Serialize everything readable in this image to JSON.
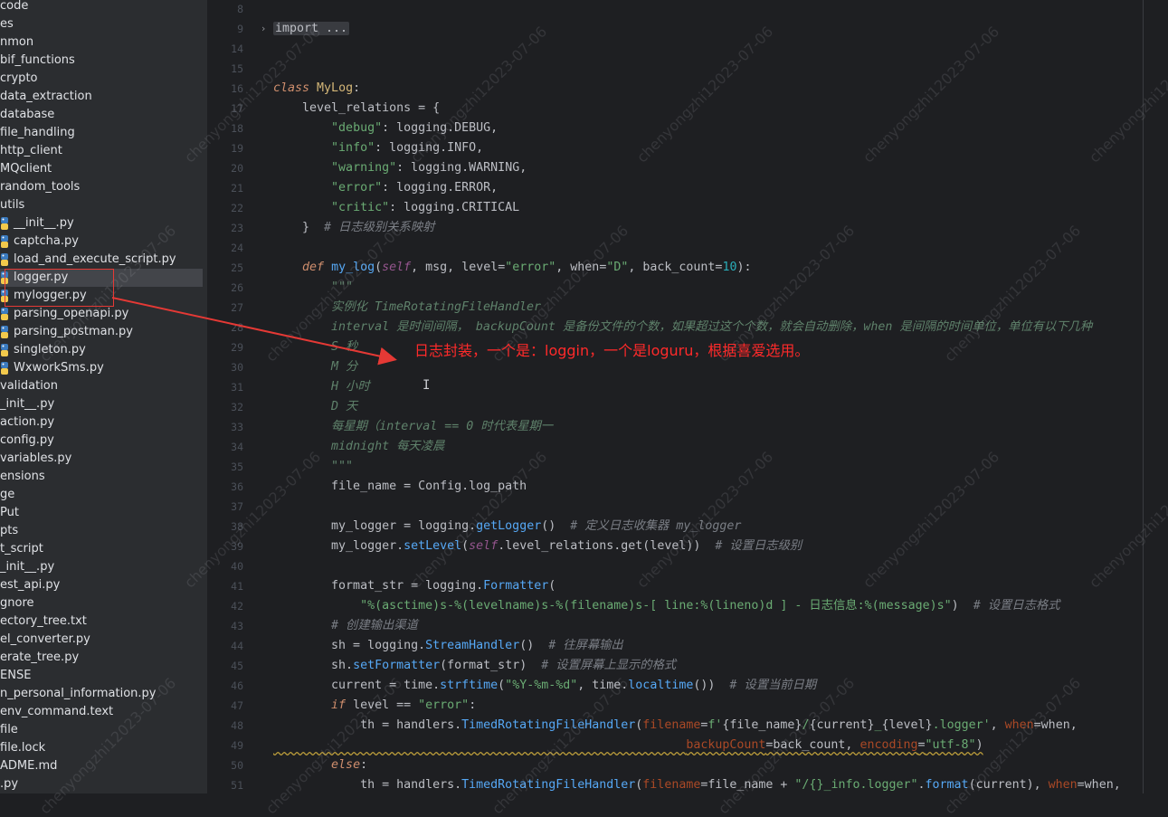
{
  "project_tree": {
    "items": [
      {
        "label": "code",
        "type": "folder"
      },
      {
        "label": "es",
        "type": "folder"
      },
      {
        "label": "nmon",
        "type": "folder"
      },
      {
        "label": "bif_functions",
        "type": "folder"
      },
      {
        "label": "crypto",
        "type": "folder"
      },
      {
        "label": "data_extraction",
        "type": "folder"
      },
      {
        "label": "database",
        "type": "folder"
      },
      {
        "label": "file_handling",
        "type": "folder"
      },
      {
        "label": "http_client",
        "type": "folder"
      },
      {
        "label": "MQclient",
        "type": "folder"
      },
      {
        "label": "random_tools",
        "type": "folder"
      },
      {
        "label": "utils",
        "type": "folder"
      },
      {
        "label": "__init__.py",
        "type": "py"
      },
      {
        "label": "captcha.py",
        "type": "py"
      },
      {
        "label": "load_and_execute_script.py",
        "type": "py"
      },
      {
        "label": "logger.py",
        "type": "py",
        "selected": true
      },
      {
        "label": "mylogger.py",
        "type": "py"
      },
      {
        "label": "parsing_openapi.py",
        "type": "py"
      },
      {
        "label": "parsing_postman.py",
        "type": "py"
      },
      {
        "label": "singleton.py",
        "type": "py"
      },
      {
        "label": "WxworkSms.py",
        "type": "py"
      },
      {
        "label": "validation",
        "type": "folder"
      },
      {
        "label": "_init__.py",
        "type": "file"
      },
      {
        "label": "action.py",
        "type": "file"
      },
      {
        "label": "config.py",
        "type": "file"
      },
      {
        "label": "variables.py",
        "type": "file"
      },
      {
        "label": "ensions",
        "type": "folder"
      },
      {
        "label": "ge",
        "type": "folder"
      },
      {
        "label": "Put",
        "type": "folder"
      },
      {
        "label": "pts",
        "type": "folder"
      },
      {
        "label": "t_script",
        "type": "folder"
      },
      {
        "label": "_init__.py",
        "type": "file"
      },
      {
        "label": "est_api.py",
        "type": "file"
      },
      {
        "label": "gnore",
        "type": "file"
      },
      {
        "label": "ectory_tree.txt",
        "type": "file"
      },
      {
        "label": "el_converter.py",
        "type": "file"
      },
      {
        "label": "erate_tree.py",
        "type": "file"
      },
      {
        "label": "ENSE",
        "type": "file"
      },
      {
        "label": "n_personal_information.py",
        "type": "file"
      },
      {
        "label": "env_command.text",
        "type": "file"
      },
      {
        "label": "file",
        "type": "file"
      },
      {
        "label": "file.lock",
        "type": "file"
      },
      {
        "label": "ADME.md",
        "type": "file"
      },
      {
        "label": ".py",
        "type": "file"
      }
    ]
  },
  "gutter": {
    "line_numbers": [
      "8",
      "9",
      "14",
      "15",
      "16",
      "17",
      "18",
      "19",
      "20",
      "21",
      "22",
      "23",
      "24",
      "25",
      "26",
      "27",
      "28",
      "29",
      "30",
      "31",
      "32",
      "33",
      "34",
      "35",
      "36",
      "37",
      "38",
      "39",
      "40",
      "41",
      "42",
      "43",
      "44",
      "45",
      "46",
      "47",
      "48",
      "49",
      "50",
      "51"
    ]
  },
  "editor": {
    "lines": [
      {
        "ln": "8",
        "tokens": []
      },
      {
        "ln": "9",
        "tokens": [
          {
            "c": "fold-import",
            "t": "import ..."
          }
        ]
      },
      {
        "ln": "14",
        "tokens": []
      },
      {
        "ln": "15",
        "tokens": []
      },
      {
        "ln": "16",
        "tokens": [
          {
            "c": "kw",
            "t": "class "
          },
          {
            "c": "cls",
            "t": "MyLog"
          },
          {
            "c": "",
            "t": ":"
          }
        ]
      },
      {
        "ln": "17",
        "tokens": [
          {
            "c": "",
            "t": "    level_relations = {"
          }
        ]
      },
      {
        "ln": "18",
        "tokens": [
          {
            "c": "",
            "t": "        "
          },
          {
            "c": "str",
            "t": "\"debug\""
          },
          {
            "c": "",
            "t": ": logging.DEBUG,"
          }
        ]
      },
      {
        "ln": "19",
        "tokens": [
          {
            "c": "",
            "t": "        "
          },
          {
            "c": "str",
            "t": "\"info\""
          },
          {
            "c": "",
            "t": ": logging.INFO,"
          }
        ]
      },
      {
        "ln": "20",
        "tokens": [
          {
            "c": "",
            "t": "        "
          },
          {
            "c": "str",
            "t": "\"warning\""
          },
          {
            "c": "",
            "t": ": logging.WARNING,"
          }
        ]
      },
      {
        "ln": "21",
        "tokens": [
          {
            "c": "",
            "t": "        "
          },
          {
            "c": "str",
            "t": "\"error\""
          },
          {
            "c": "",
            "t": ": logging.ERROR,"
          }
        ]
      },
      {
        "ln": "22",
        "tokens": [
          {
            "c": "",
            "t": "        "
          },
          {
            "c": "str",
            "t": "\"critic\""
          },
          {
            "c": "",
            "t": ": logging.CRITICAL"
          }
        ]
      },
      {
        "ln": "23",
        "tokens": [
          {
            "c": "",
            "t": "    }  "
          },
          {
            "c": "cmt",
            "t": "# 日志级别关系映射"
          }
        ]
      },
      {
        "ln": "24",
        "tokens": []
      },
      {
        "ln": "25",
        "tokens": [
          {
            "c": "",
            "t": "    "
          },
          {
            "c": "kw",
            "t": "def "
          },
          {
            "c": "fn",
            "t": "my_log"
          },
          {
            "c": "",
            "t": "("
          },
          {
            "c": "self",
            "t": "self"
          },
          {
            "c": "",
            "t": ", msg, level="
          },
          {
            "c": "str",
            "t": "\"error\""
          },
          {
            "c": "",
            "t": ", when="
          },
          {
            "c": "str",
            "t": "\"D\""
          },
          {
            "c": "",
            "t": ", back_count="
          },
          {
            "c": "num",
            "t": "10"
          },
          {
            "c": "",
            "t": "):"
          }
        ]
      },
      {
        "ln": "26",
        "tokens": [
          {
            "c": "",
            "t": "        "
          },
          {
            "c": "doc",
            "t": "\"\"\""
          }
        ]
      },
      {
        "ln": "27",
        "tokens": [
          {
            "c": "",
            "t": "        "
          },
          {
            "c": "doc",
            "t": "实例化 TimeRotatingFileHandler"
          }
        ]
      },
      {
        "ln": "28",
        "tokens": [
          {
            "c": "",
            "t": "        "
          },
          {
            "c": "doc",
            "t": "interval 是时间间隔， backupCount 是备份文件的个数，如果超过这个个数，就会自动删除，when 是间隔的时间单位，单位有以下几种"
          }
        ]
      },
      {
        "ln": "29",
        "tokens": [
          {
            "c": "",
            "t": "        "
          },
          {
            "c": "doc",
            "t": "S 秒"
          }
        ]
      },
      {
        "ln": "30",
        "tokens": [
          {
            "c": "",
            "t": "        "
          },
          {
            "c": "doc",
            "t": "M 分"
          }
        ]
      },
      {
        "ln": "31",
        "tokens": [
          {
            "c": "",
            "t": "        "
          },
          {
            "c": "doc",
            "t": "H 小时"
          }
        ]
      },
      {
        "ln": "32",
        "tokens": [
          {
            "c": "",
            "t": "        "
          },
          {
            "c": "doc",
            "t": "D 天"
          }
        ]
      },
      {
        "ln": "33",
        "tokens": [
          {
            "c": "",
            "t": "        "
          },
          {
            "c": "doc",
            "t": "每星期（interval == 0 时代表星期一"
          }
        ]
      },
      {
        "ln": "34",
        "tokens": [
          {
            "c": "",
            "t": "        "
          },
          {
            "c": "doc",
            "t": "midnight 每天凌晨"
          }
        ]
      },
      {
        "ln": "35",
        "tokens": [
          {
            "c": "",
            "t": "        "
          },
          {
            "c": "doc",
            "t": "\"\"\""
          }
        ]
      },
      {
        "ln": "36",
        "tokens": [
          {
            "c": "",
            "t": "        file_name = Config.log_path"
          }
        ]
      },
      {
        "ln": "37",
        "tokens": []
      },
      {
        "ln": "38",
        "tokens": [
          {
            "c": "",
            "t": "        my_logger = logging."
          },
          {
            "c": "fn",
            "t": "getLogger"
          },
          {
            "c": "",
            "t": "()  "
          },
          {
            "c": "cmt",
            "t": "# 定义日志收集器 my_logger"
          }
        ]
      },
      {
        "ln": "39",
        "tokens": [
          {
            "c": "",
            "t": "        my_logger."
          },
          {
            "c": "fn",
            "t": "setLevel"
          },
          {
            "c": "",
            "t": "("
          },
          {
            "c": "self",
            "t": "self"
          },
          {
            "c": "",
            "t": ".level_relations.get(level))  "
          },
          {
            "c": "cmt",
            "t": "# 设置日志级别"
          }
        ]
      },
      {
        "ln": "40",
        "tokens": []
      },
      {
        "ln": "41",
        "tokens": [
          {
            "c": "",
            "t": "        format_str = logging."
          },
          {
            "c": "fn",
            "t": "Formatter"
          },
          {
            "c": "",
            "t": "("
          }
        ]
      },
      {
        "ln": "42",
        "tokens": [
          {
            "c": "",
            "t": "            "
          },
          {
            "c": "str",
            "t": "\"%(asctime)s-%(levelname)s-%(filename)s-[ line:%(lineno)d ] - 日志信息:%(message)s\""
          },
          {
            "c": "",
            "t": ")  "
          },
          {
            "c": "cmt",
            "t": "# 设置日志格式"
          }
        ]
      },
      {
        "ln": "43",
        "tokens": [
          {
            "c": "",
            "t": "        "
          },
          {
            "c": "cmt",
            "t": "# 创建输出渠道"
          }
        ]
      },
      {
        "ln": "44",
        "tokens": [
          {
            "c": "",
            "t": "        sh = logging."
          },
          {
            "c": "fn",
            "t": "StreamHandler"
          },
          {
            "c": "",
            "t": "()  "
          },
          {
            "c": "cmt",
            "t": "# 往屏幕输出"
          }
        ]
      },
      {
        "ln": "45",
        "tokens": [
          {
            "c": "",
            "t": "        sh."
          },
          {
            "c": "fn",
            "t": "setFormatter"
          },
          {
            "c": "",
            "t": "(format_str)  "
          },
          {
            "c": "cmt",
            "t": "# 设置屏幕上显示的格式"
          }
        ]
      },
      {
        "ln": "46",
        "tokens": [
          {
            "c": "",
            "t": "        current = time."
          },
          {
            "c": "fn",
            "t": "strftime"
          },
          {
            "c": "",
            "t": "("
          },
          {
            "c": "str",
            "t": "\"%Y-%m-%d\""
          },
          {
            "c": "",
            "t": ", time."
          },
          {
            "c": "fn",
            "t": "localtime"
          },
          {
            "c": "",
            "t": "())  "
          },
          {
            "c": "cmt",
            "t": "# 设置当前日期"
          }
        ]
      },
      {
        "ln": "47",
        "tokens": [
          {
            "c": "",
            "t": "        "
          },
          {
            "c": "kw",
            "t": "if "
          },
          {
            "c": "",
            "t": "level == "
          },
          {
            "c": "str",
            "t": "\"error\""
          },
          {
            "c": "",
            "t": ":"
          }
        ]
      },
      {
        "ln": "48",
        "tokens": [
          {
            "c": "",
            "t": "            th = handlers."
          },
          {
            "c": "fn",
            "t": "TimedRotatingFileHandler"
          },
          {
            "c": "",
            "t": "("
          },
          {
            "c": "kwarg",
            "t": "filename"
          },
          {
            "c": "",
            "t": "="
          },
          {
            "c": "str",
            "t": "f'"
          },
          {
            "c": "",
            "t": "{file_name}"
          },
          {
            "c": "str",
            "t": "/"
          },
          {
            "c": "",
            "t": "{current}"
          },
          {
            "c": "str",
            "t": "_"
          },
          {
            "c": "",
            "t": "{level}"
          },
          {
            "c": "str",
            "t": ".logger'"
          },
          {
            "c": "",
            "t": ", "
          },
          {
            "c": "kwarg",
            "t": "when"
          },
          {
            "c": "",
            "t": "=when,"
          }
        ]
      },
      {
        "ln": "49",
        "tokens": [
          {
            "c": "squig",
            "t": "                                                         "
          },
          {
            "c": "kwarg squig",
            "t": "backupCount"
          },
          {
            "c": "squig",
            "t": "=back_count, "
          },
          {
            "c": "kwarg squig",
            "t": "encoding"
          },
          {
            "c": "squig",
            "t": "="
          },
          {
            "c": "str squig",
            "t": "\"utf-8\""
          },
          {
            "c": "squig",
            "t": ")"
          }
        ]
      },
      {
        "ln": "50",
        "tokens": [
          {
            "c": "",
            "t": "        "
          },
          {
            "c": "kw",
            "t": "else"
          },
          {
            "c": "",
            "t": ":"
          }
        ]
      },
      {
        "ln": "51",
        "tokens": [
          {
            "c": "",
            "t": "            th = handlers."
          },
          {
            "c": "fn",
            "t": "TimedRotatingFileHandler"
          },
          {
            "c": "",
            "t": "("
          },
          {
            "c": "kwarg",
            "t": "filename"
          },
          {
            "c": "",
            "t": "=file_name + "
          },
          {
            "c": "str",
            "t": "\"/{}_info.logger\""
          },
          {
            "c": "",
            "t": "."
          },
          {
            "c": "fn",
            "t": "format"
          },
          {
            "c": "",
            "t": "(current), "
          },
          {
            "c": "kwarg",
            "t": "when"
          },
          {
            "c": "",
            "t": "=when,"
          }
        ]
      }
    ]
  },
  "annotation": {
    "text": "日志封装，一个是：loggin，一个是loguru，根据喜爱选用。",
    "color": "#ff2a2a"
  },
  "watermark": {
    "text": "chenyongzhi12023-07-06"
  },
  "colors": {
    "background": "#1e1f22",
    "sidebar": "#2b2d30",
    "selection": "#43454a",
    "keyword": "#cf8e6d",
    "string": "#6aab73",
    "function": "#56a8f5"
  }
}
